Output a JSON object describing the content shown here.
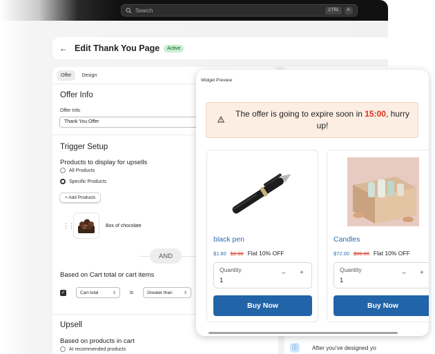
{
  "topbar": {
    "search_placeholder": "Search",
    "shortcut_1": "CTRL",
    "shortcut_2": "K"
  },
  "header": {
    "back_icon": "arrow-left-icon",
    "title": "Edit Thank You Page",
    "status_badge": "Active"
  },
  "tabs": [
    {
      "label": "Offer",
      "active": true
    },
    {
      "label": "Design",
      "active": false
    }
  ],
  "offer_info": {
    "heading": "Offer Info",
    "field_label": "Offer Info",
    "field_value": "Thank You Offer"
  },
  "trigger": {
    "heading": "Trigger Setup",
    "subheading": "Products to display for upsells",
    "options": [
      {
        "label": "All Products",
        "selected": false
      },
      {
        "label": "Specific Products",
        "selected": true
      }
    ],
    "add_button": "+ Add Products",
    "product_name": "Box of chocolate",
    "and_label": "AND",
    "cart_heading": "Based on Cart total or cart items",
    "condition": {
      "checked": true,
      "field": "Cart total",
      "operator_word": "is",
      "comparator": "Greater than"
    }
  },
  "upsell": {
    "heading": "Upsell",
    "subheading": "Based on products in cart",
    "option": "AI recommended products"
  },
  "info": {
    "text": "After you've designed yo"
  },
  "preview": {
    "label": "Widget Preview",
    "timer": {
      "message_before": "The offer is going to expire soon in ",
      "time": "15:00",
      "message_after": ", hurry up!"
    },
    "products": [
      {
        "name": "black pen",
        "sale_price": "$1.80",
        "original_price": "$2.00",
        "discount": "Flat 10% OFF",
        "quantity_label": "Quantity",
        "quantity": "1",
        "minus": "−",
        "plus": "+",
        "button": "Buy Now"
      },
      {
        "name": "Candles",
        "sale_price": "$72.00",
        "original_price": "$80.00",
        "discount": "Flat 10% OFF",
        "quantity_label": "Quantity",
        "quantity": "1",
        "minus": "−",
        "plus": "+",
        "button": "Buy Now"
      }
    ]
  },
  "colors": {
    "accent_blue": "#2164a8",
    "timer_red": "#d7351f",
    "timer_bg": "#fdeee3",
    "badge_green": "#c9f0cf"
  }
}
